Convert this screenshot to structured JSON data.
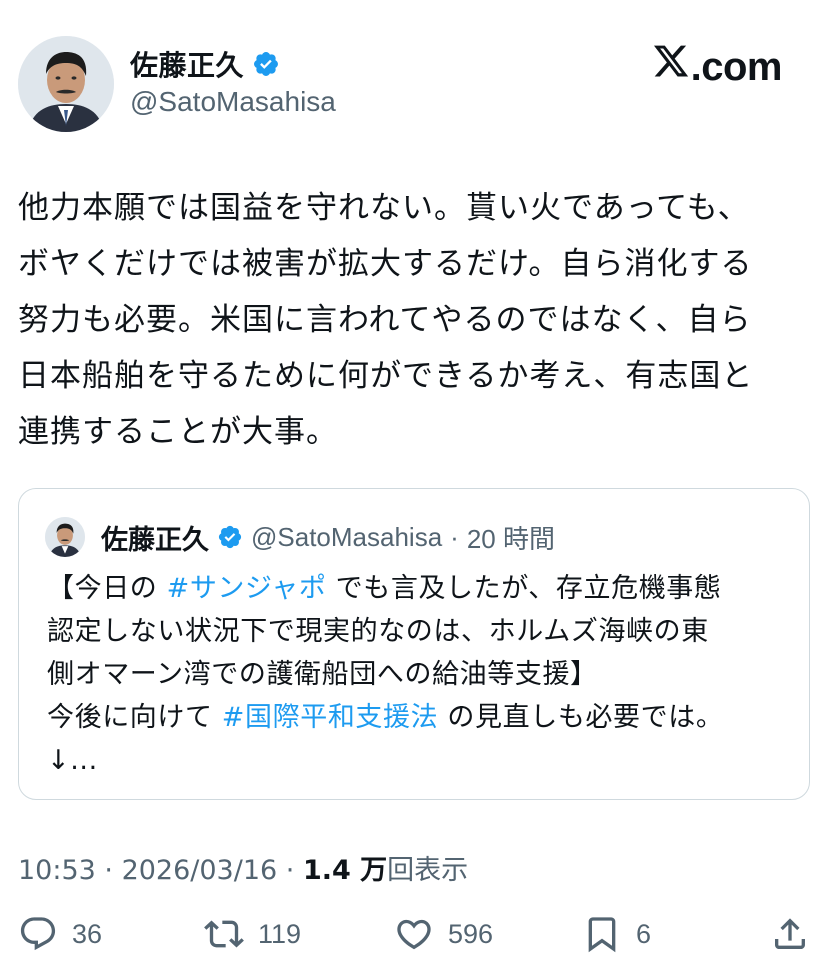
{
  "author": {
    "display_name": "佐藤正久",
    "handle": "@SatoMasahisa",
    "verified": true,
    "avatar_icon": "avatar-photo"
  },
  "brand": {
    "text": ".com",
    "icon": "x-logo-icon"
  },
  "tweet": {
    "lines": [
      "他力本願では国益を守れない。貰い火であっても、",
      "ボヤくだけでは被害が拡大するだけ。自ら消化する",
      "努力も必要。米国に言われてやるのではなく、自ら",
      "日本船舶を守るために何ができるか考え、有志国と",
      "連携することが大事。"
    ]
  },
  "quote": {
    "display_name": "佐藤正久",
    "handle": "@SatoMasahisa",
    "separator": "·",
    "time": "20 時間",
    "line1_pre": "【今日の ",
    "line1_tag": "#サンジャポ",
    "line1_post": " でも言及したが、存立危機事態",
    "line2": "認定しない状況下で現実的なのは、ホルムズ海峡の東",
    "line3": "側オマーン湾での護衛船団への給油等支援】",
    "line4_pre": "今後に向けて ",
    "line4_tag": "#国際平和支援法",
    "line4_post": " の見直しも必要では。",
    "line5": "↓..."
  },
  "meta": {
    "time": "10:53",
    "sep1": " · ",
    "date": "2026/03/16",
    "sep2": " · ",
    "views_count": "1.4 万",
    "views_label": "回表示"
  },
  "actions": {
    "replies": "36",
    "reposts": "119",
    "likes": "596",
    "bookmarks": "6"
  },
  "colors": {
    "accent": "#1d9bf0",
    "text": "#0f1419",
    "muted": "#536471",
    "border": "#cfd9de"
  }
}
